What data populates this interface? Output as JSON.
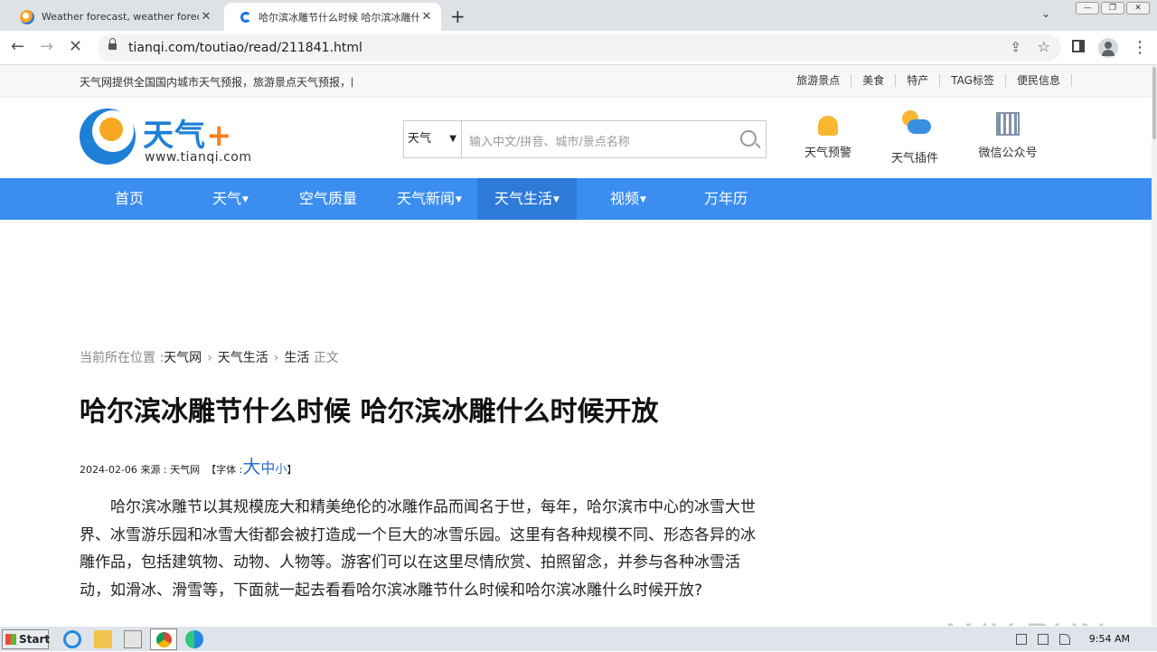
{
  "browser": {
    "tabs": [
      {
        "title": "Weather forecast, weather forecast",
        "active": false
      },
      {
        "title": "哈尔滨冰雕节什么时候 哈尔滨冰雕什么",
        "active": true
      }
    ],
    "url": "tianqi.com/toutiao/read/211841.html"
  },
  "page": {
    "top_marquee": "天气网提供全国国内城市天气预报，旅游景点天气预报，国",
    "top_links": [
      "旅游景点",
      "美食",
      "特产",
      "TAG标签",
      "便民信息"
    ],
    "logo": {
      "name": "天气",
      "plus": "+",
      "site": "www.tianqi.com"
    },
    "search": {
      "select_value": "天气",
      "placeholder": "输入中文/拼音、城市/景点名称"
    },
    "header_icons": [
      {
        "label": "天气预警",
        "icon": "weather-alert-icon"
      },
      {
        "label": "天气插件",
        "icon": "weather-plugin-icon"
      },
      {
        "label": "微信公众号",
        "icon": "wechat-qr-icon"
      }
    ],
    "nav": [
      {
        "label": "首页",
        "dropdown": false
      },
      {
        "label": "天气",
        "dropdown": true
      },
      {
        "label": "空气质量",
        "dropdown": false
      },
      {
        "label": "天气新闻",
        "dropdown": true
      },
      {
        "label": "天气生活",
        "dropdown": true,
        "active": true
      },
      {
        "label": "视频",
        "dropdown": true
      },
      {
        "label": "万年历",
        "dropdown": false
      }
    ],
    "breadcrumb": {
      "prefix": "当前所在位置 :",
      "items": [
        "天气网",
        "天气生活",
        "生活"
      ],
      "suffix": "正文"
    },
    "article": {
      "title": "哈尔滨冰雕节什么时候 哈尔滨冰雕什么时候开放",
      "date": "2024-02-06",
      "source": "来源 : 天气网",
      "font_label": "【字体 :",
      "font_sizes": [
        "大",
        "中",
        "小"
      ],
      "font_close": "】",
      "body": "哈尔滨冰雕节以其规模庞大和精美绝伦的冰雕作品而闻名于世，每年，哈尔滨市中心的冰雪大世界、冰雪游乐园和冰雪大街都会被打造成一个巨大的冰雪乐园。这里有各种规模不同、形态各异的冰雕作品，包括建筑物、动物、人物等。游客们可以在这里尽情欣赏、拍照留念，并参与各种冰雪活动，如滑冰、滑雪等，下面就一起去看看哈尔滨冰雕节什么时候和哈尔滨冰雕什么时候开放?"
    }
  },
  "watermark": "ANY RUN",
  "taskbar": {
    "start": "Start",
    "time": "9:54 AM"
  }
}
